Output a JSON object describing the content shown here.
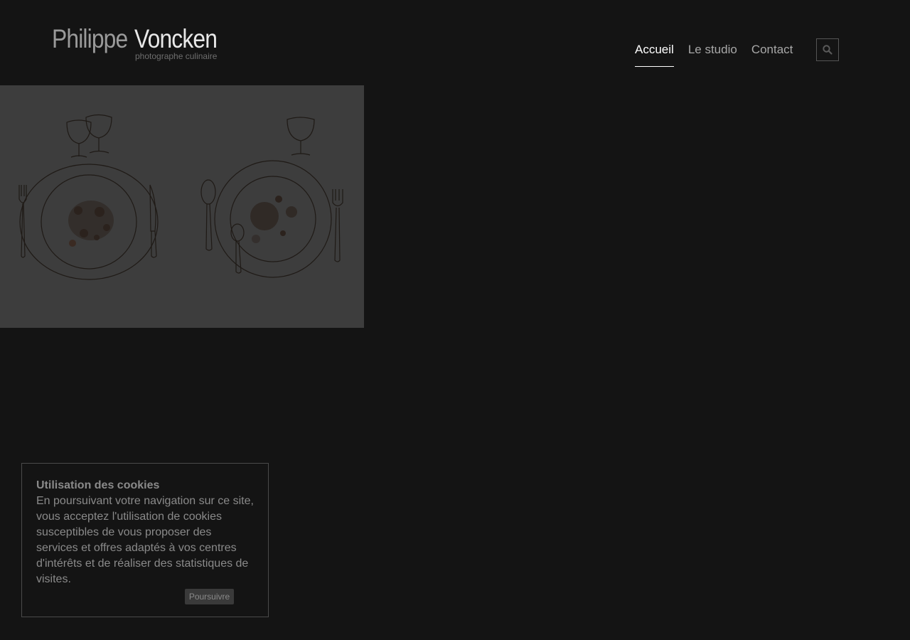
{
  "header": {
    "logo_first": "Philippe",
    "logo_last": "Voncken",
    "logo_tagline": "photographe culinaire"
  },
  "nav": {
    "items": [
      {
        "label": "Accueil",
        "active": true
      },
      {
        "label": "Le studio",
        "active": false
      },
      {
        "label": "Contact",
        "active": false
      }
    ],
    "search_icon": "search-icon"
  },
  "hero": {
    "icon": "table-setting-illustration"
  },
  "cookie_banner": {
    "title": "Utilisation des cookies",
    "text": "En poursuivant votre navigation sur ce site, vous acceptez l'utilisation de cookies susceptibles de vous proposer des services et offres adaptés à vos centres d'intérêts et de réaliser des statistiques de visites.",
    "button": "Poursuivre"
  },
  "colors": {
    "background": "#141414",
    "hero_bg": "#3d3d3d",
    "nav_active": "#ffffff",
    "nav_inactive": "#a8a8a8"
  }
}
